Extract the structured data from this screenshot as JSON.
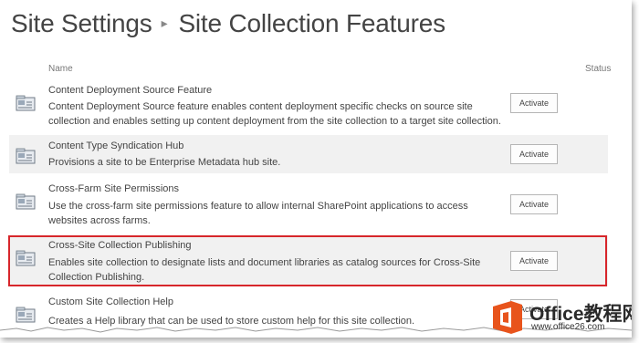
{
  "breadcrumb": {
    "root": "Site Settings",
    "current": "Site Collection Features"
  },
  "table": {
    "col_name": "Name",
    "col_status": "Status"
  },
  "features": [
    {
      "name": "Content Deployment Source Feature",
      "description": "Content Deployment Source feature enables content deployment specific checks on source site collection and enables setting up content deployment from the site collection to a target site collection.",
      "action": "Activate"
    },
    {
      "name": "Content Type Syndication Hub",
      "description": "Provisions a site to be Enterprise Metadata hub site.",
      "action": "Activate"
    },
    {
      "name": "Cross-Farm Site Permissions",
      "description": "Use the cross-farm site permissions feature to allow internal SharePoint applications to access websites across farms.",
      "action": "Activate"
    },
    {
      "name": "Cross-Site Collection Publishing",
      "description": "Enables site collection to designate lists and document libraries as catalog sources for Cross-Site Collection Publishing.",
      "action": "Activate"
    },
    {
      "name": "Custom Site Collection Help",
      "description": "Creates a Help library that can be used to store custom help for this site collection.",
      "action": "Activate"
    }
  ],
  "watermark": {
    "brand": "Office教程网",
    "url": "www.office26.com",
    "color": "#e8541c"
  },
  "colors": {
    "highlight": "#d7262b",
    "row_alt": "#f1f1f1",
    "text": "#444444"
  }
}
